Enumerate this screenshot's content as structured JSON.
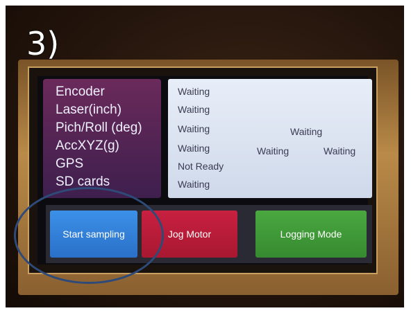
{
  "step_label": "3)",
  "status_labels": [
    "Encoder",
    "Laser(inch)",
    "Pich/Roll (deg)",
    "AccXYZ(g)",
    "GPS",
    "SD cards"
  ],
  "status_values": {
    "encoder": "Waiting",
    "laser": "Waiting",
    "pitch_roll": "Waiting",
    "pitch_roll_2": "Waiting",
    "acc": "Waiting",
    "acc_2": "Waiting",
    "acc_3": "Waiting",
    "gps": "Not Ready",
    "sd": "Waiting"
  },
  "buttons": {
    "start": "Start sampling",
    "jog": "Jog Motor",
    "logging": "Logging Mode"
  },
  "colors": {
    "start": "#2a70c8",
    "jog": "#a81830",
    "logging": "#368a30",
    "annotation": "#2e4a78"
  }
}
